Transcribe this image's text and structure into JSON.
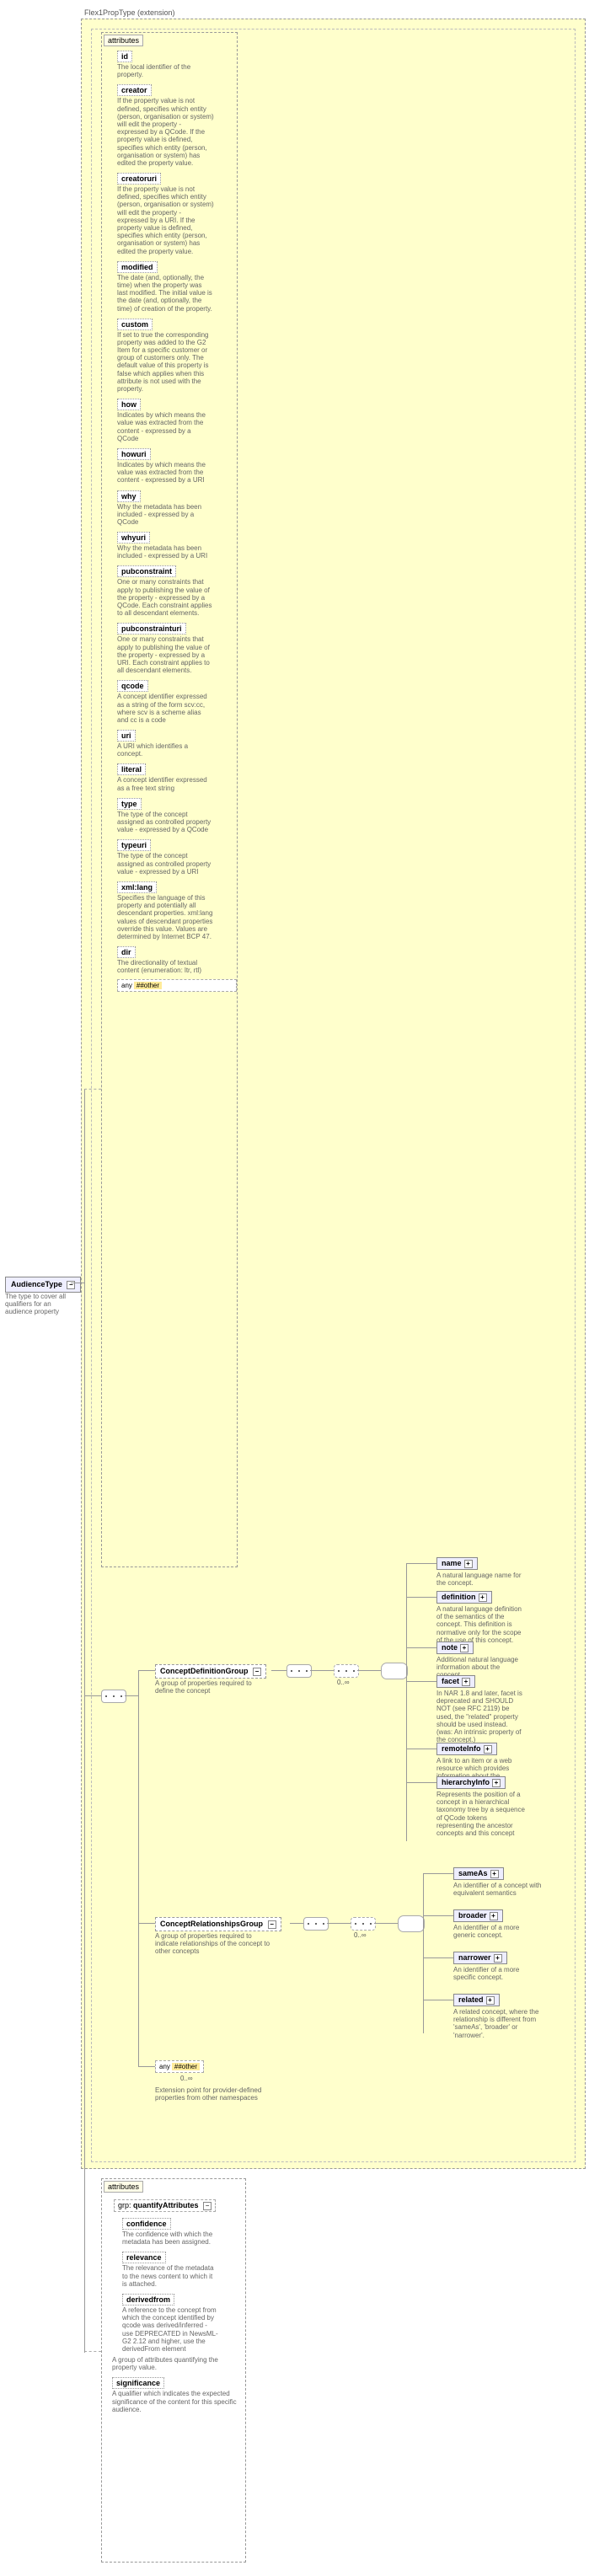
{
  "extension_title": "Flex1PropType (extension)",
  "root": {
    "name": "AudienceType",
    "desc": "The type to cover all qualifiers for an audience property"
  },
  "attributes_header": "attributes",
  "attrs": [
    {
      "name": "id",
      "desc": "The local identifier of the property."
    },
    {
      "name": "creator",
      "desc": "If the property value is not defined, specifies which entity (person, organisation or system) will edit the property - expressed by a QCode. If the property value is defined, specifies which entity (person, organisation or system) has edited the property value."
    },
    {
      "name": "creatoruri",
      "desc": "If the property value is not defined, specifies which entity (person, organisation or system) will edit the property - expressed by a URI. If the property value is defined, specifies which entity (person, organisation or system) has edited the property value."
    },
    {
      "name": "modified",
      "desc": "The date (and, optionally, the time) when the property was last modified. The initial value is the date (and, optionally, the time) of creation of the property."
    },
    {
      "name": "custom",
      "desc": "If set to true the corresponding property was added to the G2 Item for a specific customer or group of customers only. The default value of this property is false which applies when this attribute is not used with the property."
    },
    {
      "name": "how",
      "desc": "Indicates by which means the value was extracted from the content - expressed by a QCode"
    },
    {
      "name": "howuri",
      "desc": "Indicates by which means the value was extracted from the content - expressed by a URI"
    },
    {
      "name": "why",
      "desc": "Why the metadata has been included - expressed by a QCode"
    },
    {
      "name": "whyuri",
      "desc": "Why the metadata has been included - expressed by a URI"
    },
    {
      "name": "pubconstraint",
      "desc": "One or many constraints that apply to publishing the value of the property - expressed by a QCode. Each constraint applies to all descendant elements."
    },
    {
      "name": "pubconstrainturi",
      "desc": "One or many constraints that apply to publishing the value of the property - expressed by a URI. Each constraint applies to all descendant elements."
    },
    {
      "name": "qcode",
      "desc": "A concept identifier expressed as a string of the form scv:cc, where scv is a scheme alias and cc is a code"
    },
    {
      "name": "uri",
      "desc": "A URI which identifies a concept."
    },
    {
      "name": "literal",
      "desc": "A concept identifier expressed as a free text string"
    },
    {
      "name": "type",
      "desc": "The type of the concept assigned as controlled property value - expressed by a QCode"
    },
    {
      "name": "typeuri",
      "desc": "The type of the concept assigned as controlled property value - expressed by a URI"
    },
    {
      "name": "xml:lang",
      "desc": "Specifies the language of this property and potentially all descendant properties. xml:lang values of descendant properties override this value. Values are determined by Internet BCP 47."
    },
    {
      "name": "dir",
      "desc": "The directionality of textual content (enumeration: ltr, rtl)"
    }
  ],
  "any1": {
    "label": "any",
    "ns": "##other"
  },
  "cdg": {
    "name": "ConceptDefinitionGroup",
    "desc": "A group of properties required to define the concept"
  },
  "crg": {
    "name": "ConceptRelationshipsGroup",
    "desc": "A group of properties required to indicate relationships of the concept to other concepts"
  },
  "cdg_children": [
    {
      "name": "name",
      "desc": "A natural language name for the concept."
    },
    {
      "name": "definition",
      "desc": "A natural language definition of the semantics of the concept. This definition is normative only for the scope of the use of this concept."
    },
    {
      "name": "note",
      "desc": "Additional natural language information about the concept."
    },
    {
      "name": "facet",
      "desc": "In NAR 1.8 and later, facet is deprecated and SHOULD NOT (see RFC 2119) be used, the \"related\" property should be used instead. (was: An intrinsic property of the concept.)"
    },
    {
      "name": "remoteInfo",
      "desc": "A link to an item or a web resource which provides information about the concept"
    },
    {
      "name": "hierarchyInfo",
      "desc": "Represents the position of a concept in a hierarchical taxonomy tree by a sequence of QCode tokens representing the ancestor concepts and this concept"
    }
  ],
  "crg_children": [
    {
      "name": "sameAs",
      "desc": "An identifier of a concept with equivalent semantics"
    },
    {
      "name": "broader",
      "desc": "An identifier of a more generic concept."
    },
    {
      "name": "narrower",
      "desc": "An identifier of a more specific concept."
    },
    {
      "name": "related",
      "desc": "A related concept, where the relationship is different from 'sameAs', 'broader' or 'narrower'."
    }
  ],
  "any2": {
    "label": "any",
    "ns": "##other",
    "desc": "Extension point for provider-defined properties from other namespaces"
  },
  "occ": "0..∞",
  "attributes2_header": "attributes",
  "grp_label": "grp:",
  "quantify": {
    "name": "quantifyAttributes"
  },
  "attrs2": [
    {
      "name": "confidence",
      "desc": "The confidence with which the metadata has been assigned."
    },
    {
      "name": "relevance",
      "desc": "The relevance of the metadata to the news content to which it is attached."
    },
    {
      "name": "derivedfrom",
      "desc": "A reference to the concept from which the concept identified by qcode was derived/inferred - use DEPRECATED in NewsML-G2 2.12 and higher, use the derivedFrom element"
    }
  ],
  "quantify_desc": "A group of attributes quantifying the property value.",
  "significance": {
    "name": "significance",
    "desc": "A qualifier which indicates the expected significance of the content for this specific audience."
  }
}
